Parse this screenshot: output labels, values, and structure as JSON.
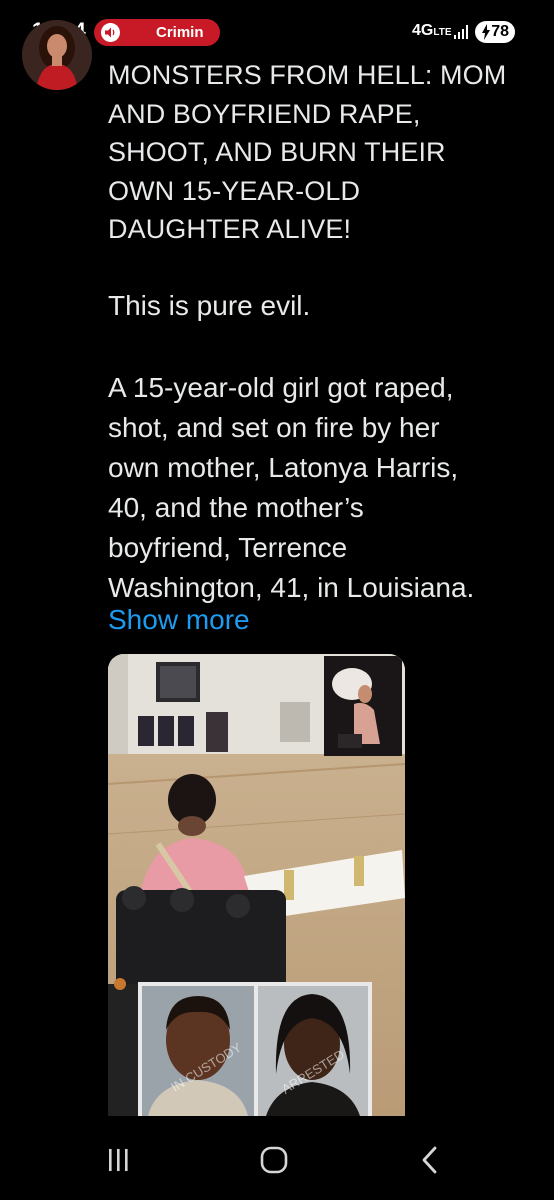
{
  "status_bar": {
    "time": "16:34",
    "notification_label": "Crimin",
    "network": "4G",
    "network_suffix": "LTE",
    "battery": "78"
  },
  "tweet": {
    "headline_lines": [
      "MONSTERS FROM HELL: MOM",
      "AND BOYFRIEND RAPE,",
      "SHOOT, AND BURN THEIR",
      "OWN 15-YEAR-OLD",
      "DAUGHTER ALIVE!"
    ],
    "paragraph_1": "This is pure evil.",
    "paragraph_2_lines": [
      "A 15-year-old girl got raped,",
      "shot, and set on fire by her",
      "own mother, Latonya Harris,",
      "40, and the mother’s",
      "boyfriend, Terrence",
      "Washington, 41, in Louisiana."
    ],
    "show_more": "Show more"
  },
  "media": {
    "watermark_left": "IN CUSTODY",
    "watermark_right": "ARRESTED"
  },
  "colors": {
    "background": "#000000",
    "text": "#e7e9ea",
    "link": "#1d9bf0",
    "pill": "#c81a26"
  },
  "icons": [
    "speaker-icon",
    "signal-icon",
    "bolt-icon",
    "recents-icon",
    "home-icon",
    "back-icon"
  ]
}
